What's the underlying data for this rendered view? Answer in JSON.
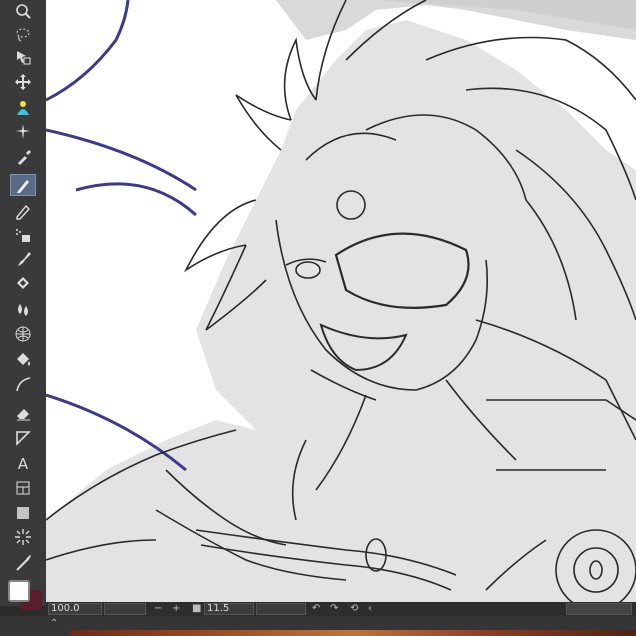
{
  "toolbar": {
    "tools": [
      {
        "icon": "zoom-icon",
        "active": false
      },
      {
        "icon": "lasso-icon",
        "active": false
      },
      {
        "icon": "select-layer-icon",
        "active": false
      },
      {
        "icon": "move-icon",
        "active": false
      },
      {
        "icon": "fill-bucket-icon",
        "active": false
      },
      {
        "icon": "magic-wand-icon",
        "active": false
      },
      {
        "icon": "eyedropper-icon",
        "active": false
      },
      {
        "icon": "pen-icon",
        "active": true
      },
      {
        "icon": "pencil-icon",
        "active": false
      },
      {
        "icon": "airbrush-icon",
        "active": false
      },
      {
        "icon": "brush-icon",
        "active": false
      },
      {
        "icon": "decoration-icon",
        "active": false
      },
      {
        "icon": "blend-icon",
        "active": false
      },
      {
        "icon": "mesh-transform-icon",
        "active": false
      },
      {
        "icon": "paint-fill-icon",
        "active": false
      },
      {
        "icon": "curve-icon",
        "active": false
      },
      {
        "icon": "eraser-icon",
        "active": false
      },
      {
        "icon": "figure-icon",
        "active": false
      },
      {
        "icon": "text-icon",
        "active": false
      },
      {
        "icon": "frame-icon",
        "active": false
      },
      {
        "icon": "gradient-icon",
        "active": false
      },
      {
        "icon": "burst-icon",
        "active": false
      },
      {
        "icon": "correct-line-icon",
        "active": false
      }
    ],
    "text_tool_glyph": "A"
  },
  "colors": {
    "foreground": "#ffffff",
    "background": "#5a1e2a",
    "active_tool": "#5a6b86"
  },
  "statusbar": {
    "zoom": "100.0",
    "minus": "−",
    "plus": "+",
    "brush_size": "11.5",
    "rotate_left": "↶",
    "rotate_right": "↷",
    "reset": "⟲",
    "collapse": "‹"
  }
}
